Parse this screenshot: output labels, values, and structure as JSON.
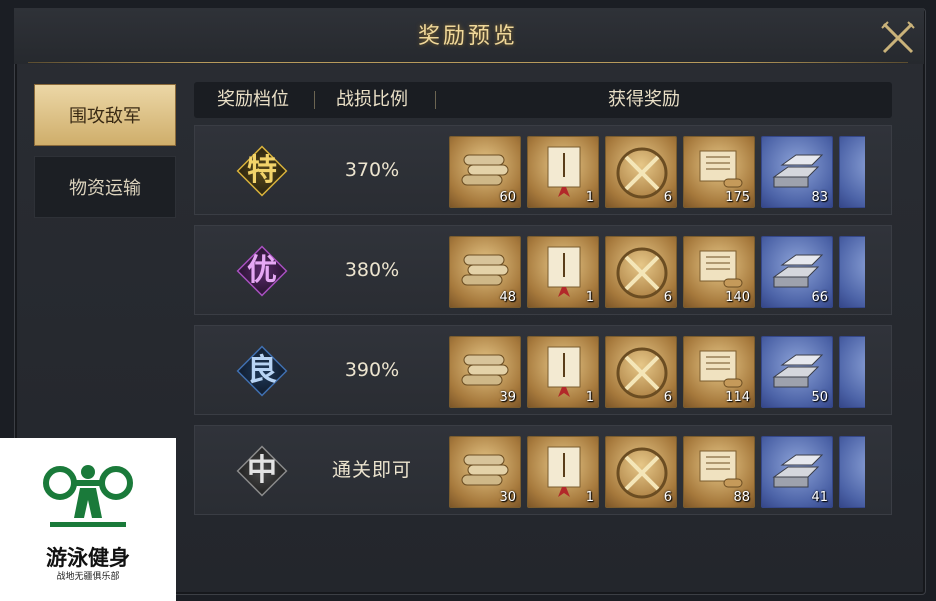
{
  "window": {
    "title": "奖励预览"
  },
  "tabs": [
    {
      "label": "围攻敌军",
      "active": true
    },
    {
      "label": "物资运输",
      "active": false
    }
  ],
  "table": {
    "headers": [
      "奖励档位",
      "战损比例",
      "获得奖励"
    ],
    "rows": [
      {
        "grade": "特",
        "grade_color": "#d9b23a",
        "ratio": "370%",
        "counts": [
          "60",
          "1",
          "6",
          "175",
          "83"
        ]
      },
      {
        "grade": "优",
        "grade_color": "#a84fc0",
        "ratio": "380%",
        "counts": [
          "48",
          "1",
          "6",
          "140",
          "66"
        ]
      },
      {
        "grade": "良",
        "grade_color": "#3f6fb0",
        "ratio": "390%",
        "counts": [
          "39",
          "1",
          "6",
          "114",
          "50"
        ]
      },
      {
        "grade": "中",
        "grade_color": "#8a8a8a",
        "ratio": "通关即可",
        "counts": [
          "30",
          "1",
          "6",
          "88",
          "41"
        ]
      }
    ],
    "item_icons": [
      "scroll-bundle-icon",
      "decree-book-icon",
      "crossed-swords-icon",
      "open-scroll-icon",
      "silver-ingot-icon"
    ]
  },
  "watermark": {
    "name": "游泳健身",
    "sub": "战地无疆俱乐部"
  },
  "colors": {
    "accent_gold": "#f0d89a",
    "tab_active_bg": "#ecd7a6"
  }
}
